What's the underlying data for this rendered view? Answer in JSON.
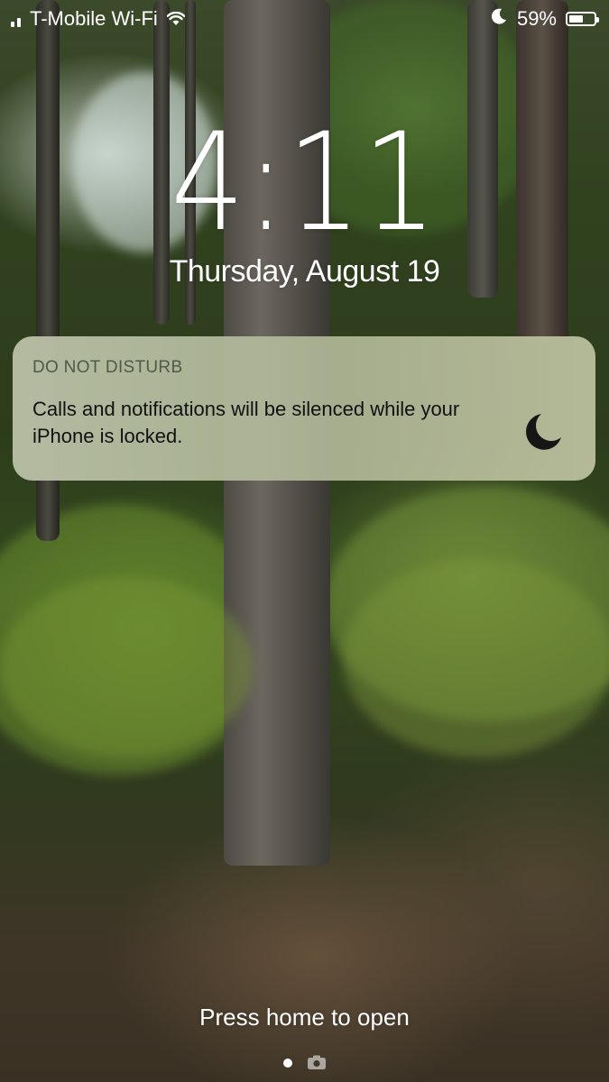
{
  "status_bar": {
    "carrier": "T-Mobile Wi-Fi",
    "battery_percent": "59%",
    "battery_level": 0.59,
    "icons": {
      "signal": "cellular-signal-icon",
      "wifi": "wifi-icon",
      "do_not_disturb": "moon-icon",
      "battery": "battery-icon"
    }
  },
  "lock_screen": {
    "time": "4:11",
    "date": "Thursday, August 19"
  },
  "notification": {
    "app": "DO NOT DISTURB",
    "message": "Calls and notifications will be silenced while your iPhone is locked.",
    "icon": "moon-icon"
  },
  "bottom": {
    "hint": "Press home to open",
    "page_indicator_icon": "camera-icon"
  },
  "colors": {
    "text_primary": "#ffffff",
    "notification_bg": "#b4b996",
    "notification_title": "#4f5a48",
    "notification_text": "#111111"
  }
}
